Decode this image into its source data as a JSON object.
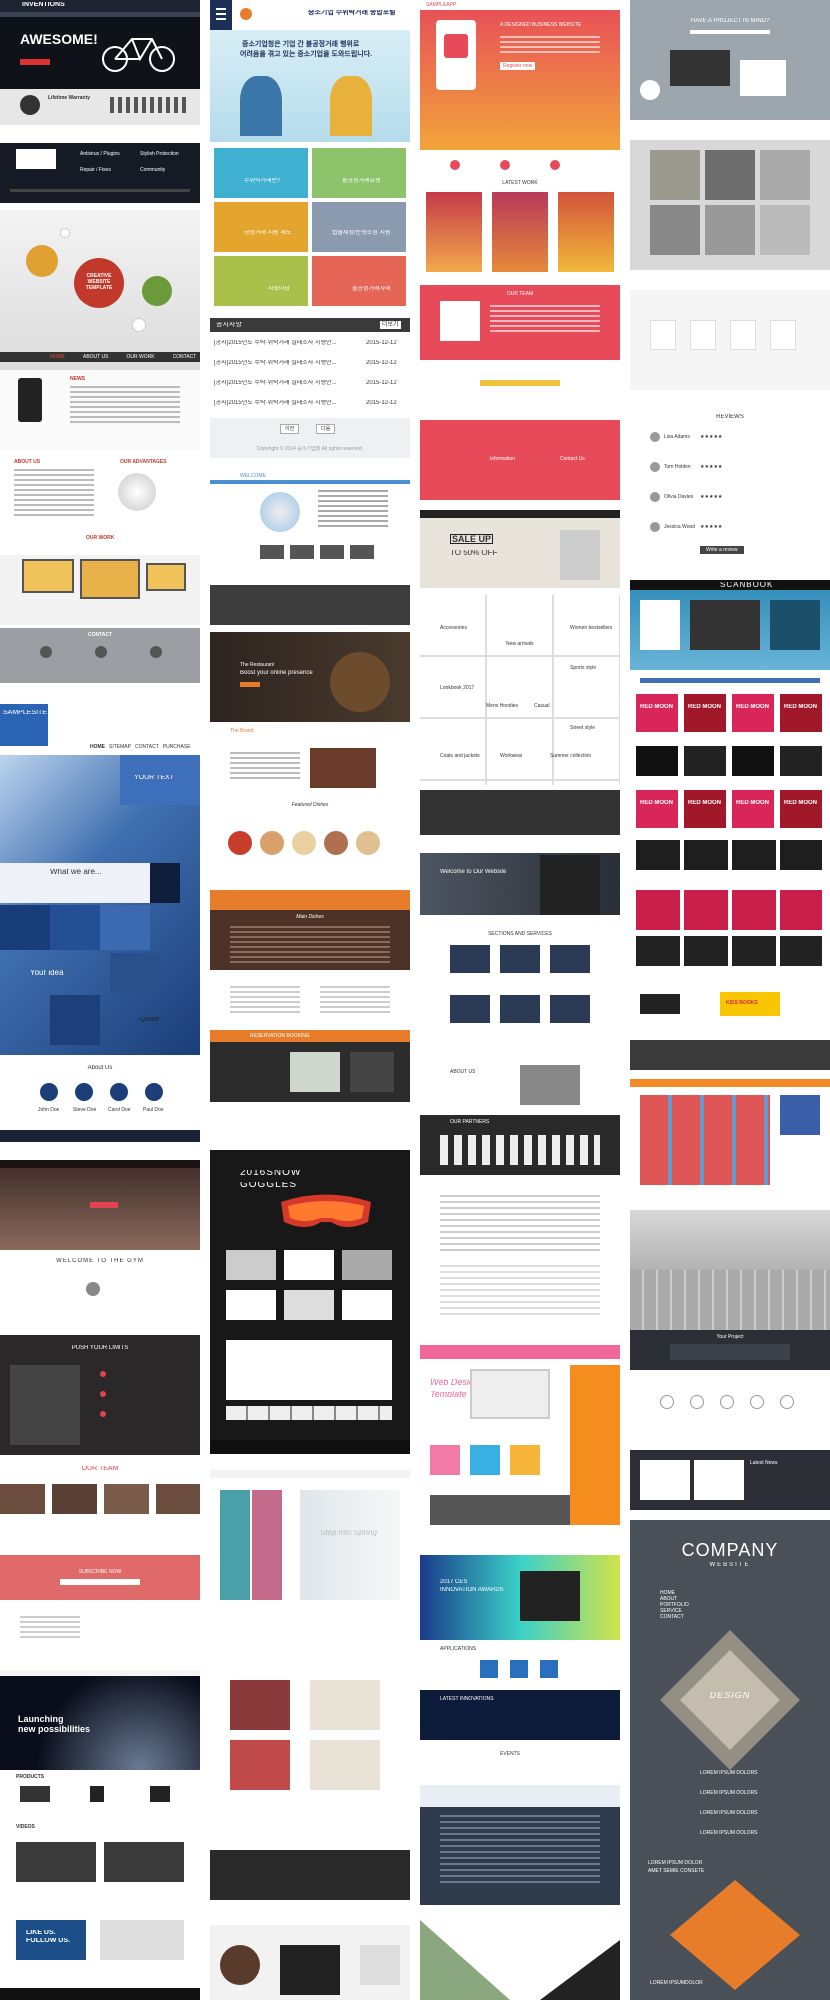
{
  "col1": {
    "inventions": {
      "brand": "INVENTIONS",
      "hero": "AWESOME!",
      "warranty": "Lifetime Warranty",
      "features": [
        "Antivirus / Plugins",
        "Stylish Protection",
        "Repair / Fixes",
        "Community"
      ]
    },
    "creative": {
      "hero": [
        "CREATIVE",
        "WEBSITE",
        "TEMPLATE"
      ],
      "nav": [
        "HOME",
        "ABOUT US",
        "OUR WORK",
        "CONTACT"
      ],
      "news": "NEWS",
      "about": "ABOUT US",
      "advantages": "OUR ADVANTAGES",
      "work": "OUR WORK",
      "contact": "CONTACT"
    },
    "samplesite": {
      "logo": "SAMPLESITE",
      "nav": [
        "HOME",
        "SITEMAP",
        "CONTACT",
        "PURCHASE"
      ],
      "your_text": "YOUR TEXT",
      "what_we_are": "What we are...",
      "your_idea": "Your idea",
      "quote": "Quote",
      "about": "About Us",
      "team": [
        "John Doe",
        "Steve Doe",
        "Carol Doe",
        "Paul Doe"
      ]
    },
    "gym": {
      "welcome": "WELCOME TO THE GYM",
      "push": "PUSH YOUR LIMITS",
      "team": "OUR TEAM",
      "subscribe": "SUBSCRIBE NOW"
    },
    "samsung": {
      "hero": [
        "Launching",
        "new possibilities"
      ],
      "products": "PRODUCTS",
      "videos": "VIDEOS",
      "like_us": [
        "LIKE US.",
        "FOLLOW US."
      ]
    }
  },
  "col2": {
    "korean": {
      "title": "중소기업 수위탁거래 종합포털",
      "banner": [
        "중소기업청은 기업 간 불공정거래 행위로",
        "어려움을 겪고 있는 중소기업을 도와드립니다."
      ],
      "tiles": [
        "수위탁거래란?",
        "불공정거래유형",
        "공정거래 지원 제도",
        "법률제정/분쟁조정 지원",
        "자료마당",
        "불공정거래사례"
      ],
      "notice_title": "공지사항",
      "more": "더보기",
      "notices": [
        {
          "text": "[공지]2015년도 수탁·위탁거래 실태조사 시행안...",
          "date": "2015-12-12"
        },
        {
          "text": "[공지]2015년도 수탁·위탁거래 실태조사 시행안...",
          "date": "2015-12-12"
        },
        {
          "text": "[공지]2015년도 수탁·위탁거래 실태조사 시행안...",
          "date": "2015-12-12"
        },
        {
          "text": "[공지]2015년도 수탁·위탁거래 실태조사 시행안...",
          "date": "2015-12-12"
        }
      ],
      "buttons": [
        "이전",
        "다음"
      ],
      "copyright": "Copyright © 2014 중소기업청 All rights reserved."
    },
    "welcome": {
      "brand": "WELCOME"
    },
    "restaurant": {
      "hero": [
        "The Restaurant",
        "Boost your online presence"
      ],
      "brand": "The Brand",
      "featured": "Featured Dishes",
      "menu": "Main Dishes",
      "reservation": "RESERVATION BOOKING"
    },
    "snow": {
      "title": "2016SNOW",
      "sub": "GOGGLES"
    },
    "fashion": {
      "hero": "Step into Spring"
    }
  },
  "col3": {
    "app": {
      "brand": "SAMPLEAPP",
      "hero": "A DESIGNED BUSINESS WEBSITE",
      "cta": "Register now",
      "latest": "LATEST WORK",
      "team": "OUR TEAM",
      "info": [
        "Information",
        "Contact Us"
      ]
    },
    "sale": {
      "sale": "SALE UP",
      "pct": "TO 50% OFF",
      "cats": [
        "Accessories",
        "New arrivals",
        "Women bestsellers",
        "Lookbook 2017",
        "Sports style",
        "Mens Hoodies",
        "Casual",
        "Street style",
        "Coats and jackets",
        "Workwear",
        "Summer collection"
      ]
    },
    "corp": {
      "hero": "Welcome to Our Website",
      "sections": "SECTIONS AND SERVICES",
      "about": "ABOUT US",
      "partners": "OUR PARTNERS"
    },
    "webdesign": {
      "title": [
        "Web Design",
        "Template"
      ]
    },
    "awards": {
      "hero": [
        "2017 CES",
        "INNOVATION AWARDS"
      ],
      "apps": "APPLICATIONS",
      "innovation": "LATEST INNOVATIONS",
      "events": "EVENTS"
    }
  },
  "col4": {
    "project": {
      "hero": "HAVE A PROJECT IN MIND?"
    },
    "reviews": {
      "title": "REVIEWS",
      "names": [
        "Lisa Adams",
        "Tom Holden",
        "Olivia Davies",
        "Jessica Wood"
      ],
      "button": "Write a review"
    },
    "scanbook": {
      "brand": "SCANBOOK",
      "books": [
        "RED MOON",
        "RED MOON",
        "RED MOON",
        "RED MOON",
        "RED MOON",
        "RED MOON",
        "RED MOON",
        "RED MOON"
      ],
      "kids": "KIDS BOOKS"
    },
    "keyboard": {
      "project": "Your Project",
      "news": "Latest News"
    },
    "company": {
      "title": "COMPANY",
      "sub": "WEBSITE",
      "design": "DESIGN",
      "menu": [
        "HOME",
        "ABOUT",
        "PORTFOLIO",
        "SERVICE",
        "CONTACT"
      ],
      "lorem": [
        "LOREM IPSUM DOLORS",
        "LOREM IPSUM DOLORS",
        "LOREM IPSUM DOLORS",
        "LOREM IPSUM DOLORS"
      ],
      "foot": [
        "LOREM IPSUM DOLOR",
        "AMET SEMIE CONSETE"
      ],
      "foot2": "LOREM IPSUMDOLOR"
    }
  },
  "colors": {
    "red": "#e0434f",
    "navy": "#1b2f57",
    "gym_dark": "#231c1c",
    "orange": "#e77d2b",
    "gold": "#c9a64e",
    "blue": "#2a6fbd"
  }
}
